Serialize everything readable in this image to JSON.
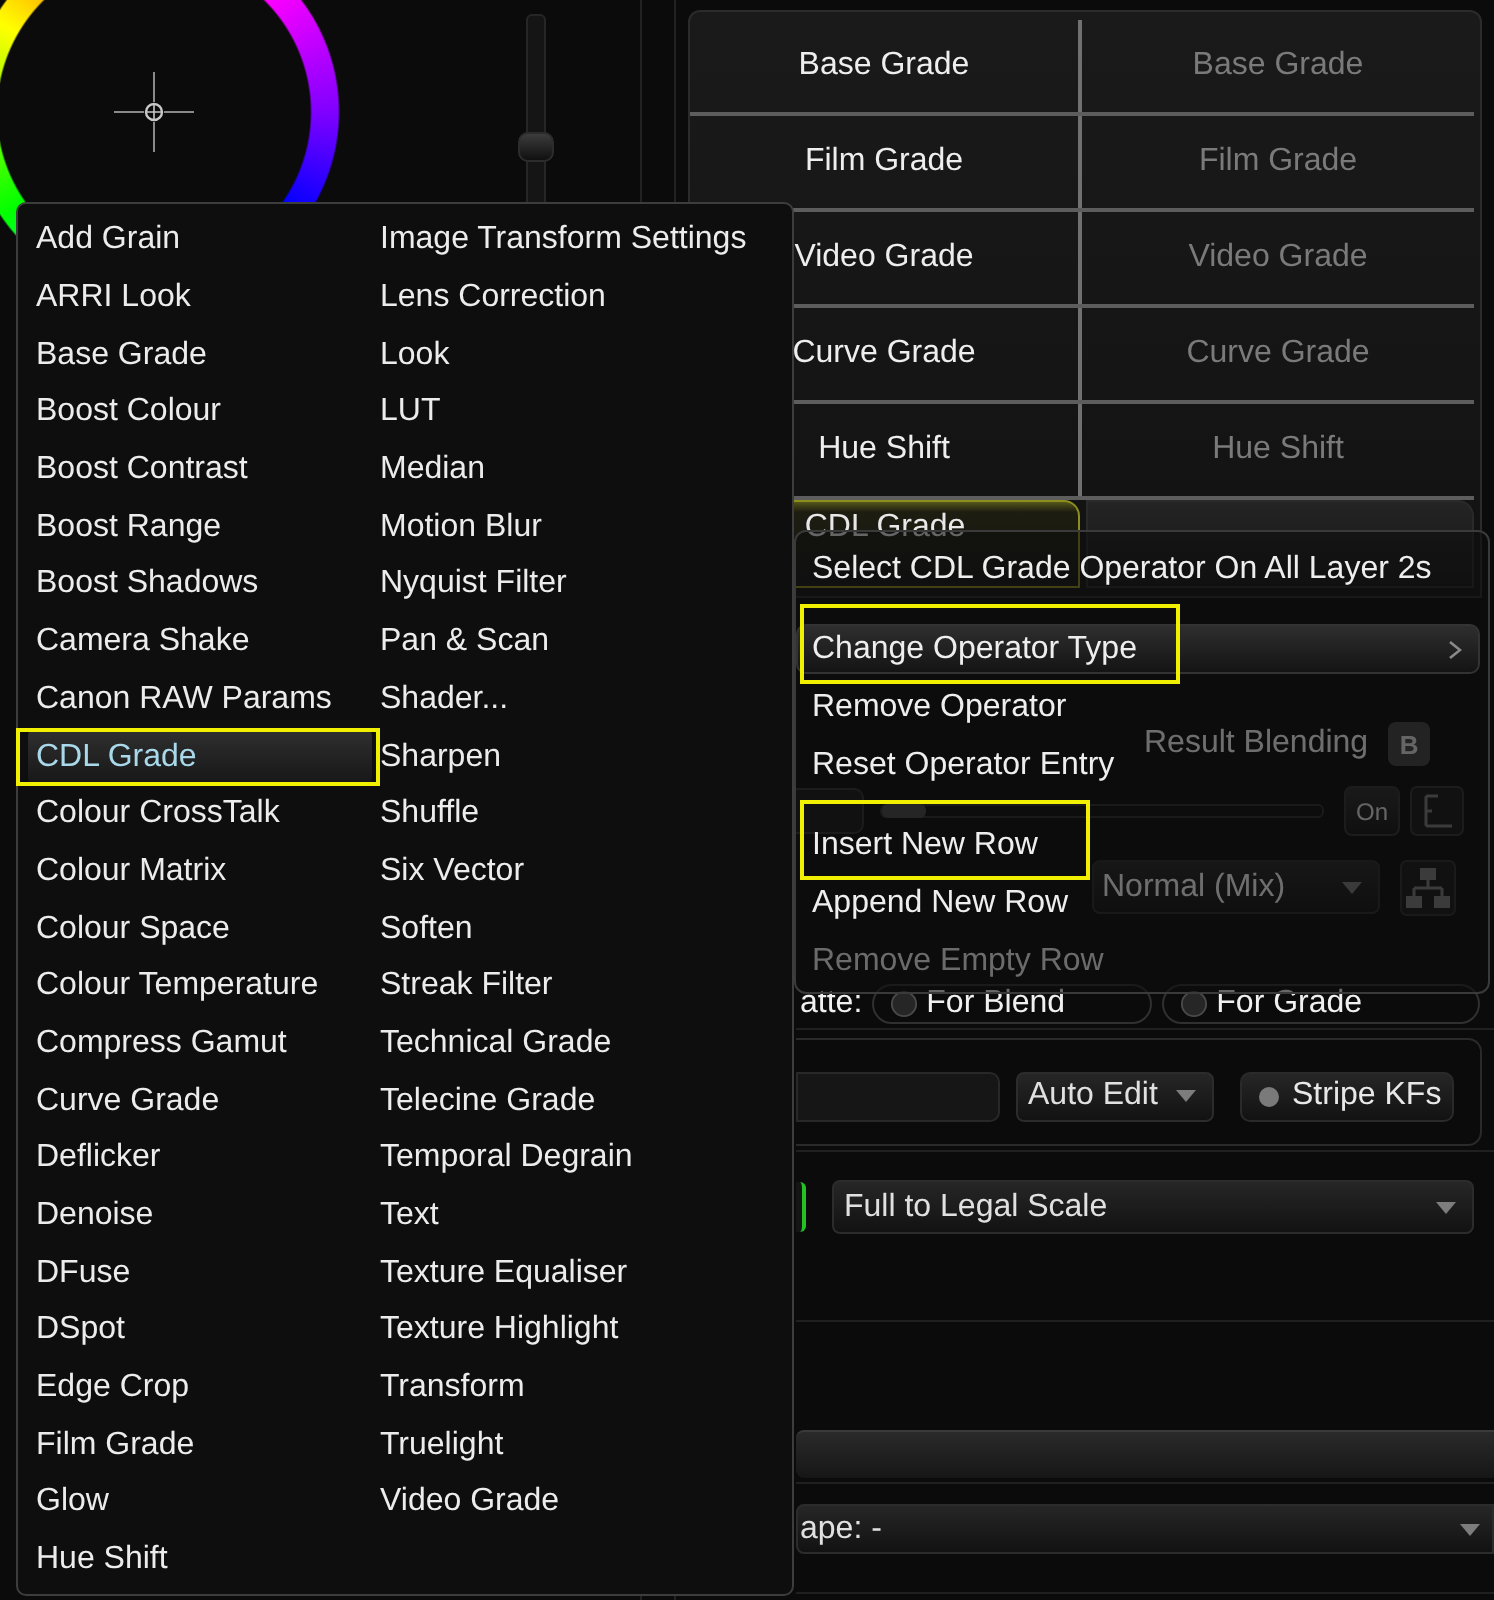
{
  "wheel_slider": {
    "level": 0.5
  },
  "grade_grid": {
    "rows": [
      {
        "kind": "cell",
        "cells": [
          {
            "label": "Base Grade",
            "disabled": false,
            "selected": false
          },
          {
            "label": "Base Grade",
            "disabled": true,
            "selected": false
          }
        ]
      },
      {
        "kind": "cell",
        "cells": [
          {
            "label": "Film Grade",
            "disabled": false,
            "selected": false
          },
          {
            "label": "Film Grade",
            "disabled": true,
            "selected": false
          }
        ]
      },
      {
        "kind": "cell",
        "cells": [
          {
            "label": "Video Grade",
            "disabled": false,
            "selected": false
          },
          {
            "label": "Video Grade",
            "disabled": true,
            "selected": false
          }
        ]
      },
      {
        "kind": "cell",
        "cells": [
          {
            "label": "Curve Grade",
            "disabled": false,
            "selected": false
          },
          {
            "label": "Curve Grade",
            "disabled": true,
            "selected": false
          }
        ]
      },
      {
        "kind": "cell",
        "cells": [
          {
            "label": "Hue Shift",
            "disabled": false,
            "selected": false
          },
          {
            "label": "Hue Shift",
            "disabled": true,
            "selected": false
          }
        ]
      },
      {
        "kind": "tile",
        "cells": [
          {
            "label": "CDL Grade",
            "disabled": false,
            "selected": true
          }
        ]
      }
    ]
  },
  "operator_panel": {
    "result_blending": {
      "label": "Result Blending",
      "badge": "B"
    },
    "mix_slider": {
      "level": 0,
      "button": "On"
    },
    "blend_mode": {
      "value": "Normal (Mix)"
    },
    "matte": {
      "label": "atte:",
      "options": [
        {
          "label": "For Blend",
          "selected": false
        },
        {
          "label": "For Grade",
          "selected": false
        }
      ]
    }
  },
  "keyframe_bar": {
    "mode": {
      "value": "Auto Edit"
    },
    "stripe_kfs": {
      "label": "Stripe KFs",
      "on": false
    }
  },
  "scale_row": {
    "indicator": {
      "on": true
    },
    "scale": {
      "value": "Full to Legal Scale"
    }
  },
  "shape_dropdown": {
    "value": "ape: -"
  },
  "context_menu": {
    "groups": [
      {
        "items": [
          {
            "label": "Select CDL Grade Operator On All Layer 2s",
            "selected": false,
            "disabled": false,
            "submenu": false,
            "annotated": false
          }
        ]
      },
      {
        "items": [
          {
            "label": "Change Operator Type",
            "selected": true,
            "disabled": false,
            "submenu": true,
            "annotated": true
          },
          {
            "label": "Remove Operator",
            "selected": false,
            "disabled": false,
            "submenu": false,
            "annotated": false
          },
          {
            "label": "Reset Operator Entry",
            "selected": false,
            "disabled": false,
            "submenu": false,
            "annotated": false
          }
        ]
      },
      {
        "items": [
          {
            "label": "Insert New Row",
            "selected": false,
            "disabled": false,
            "submenu": false,
            "annotated": true
          },
          {
            "label": "Append New Row",
            "selected": false,
            "disabled": false,
            "submenu": false,
            "annotated": false
          },
          {
            "label": "Remove Empty Row",
            "selected": false,
            "disabled": true,
            "submenu": false,
            "annotated": false
          }
        ]
      }
    ]
  },
  "operator_type_menu": {
    "columns": [
      {
        "items": [
          {
            "label": "Add Grain",
            "selected": false,
            "annotated": false
          },
          {
            "label": "ARRI Look",
            "selected": false,
            "annotated": false
          },
          {
            "label": "Base Grade",
            "selected": false,
            "annotated": false
          },
          {
            "label": "Boost Colour",
            "selected": false,
            "annotated": false
          },
          {
            "label": "Boost Contrast",
            "selected": false,
            "annotated": false
          },
          {
            "label": "Boost Range",
            "selected": false,
            "annotated": false
          },
          {
            "label": "Boost Shadows",
            "selected": false,
            "annotated": false
          },
          {
            "label": "Camera Shake",
            "selected": false,
            "annotated": false
          },
          {
            "label": "Canon RAW Params",
            "selected": false,
            "annotated": false
          },
          {
            "label": "CDL Grade",
            "selected": true,
            "annotated": true
          },
          {
            "label": "Colour CrossTalk",
            "selected": false,
            "annotated": false
          },
          {
            "label": "Colour Matrix",
            "selected": false,
            "annotated": false
          },
          {
            "label": "Colour Space",
            "selected": false,
            "annotated": false
          },
          {
            "label": "Colour Temperature",
            "selected": false,
            "annotated": false
          },
          {
            "label": "Compress Gamut",
            "selected": false,
            "annotated": false
          },
          {
            "label": "Curve Grade",
            "selected": false,
            "annotated": false
          },
          {
            "label": "Deflicker",
            "selected": false,
            "annotated": false
          },
          {
            "label": "Denoise",
            "selected": false,
            "annotated": false
          },
          {
            "label": "DFuse",
            "selected": false,
            "annotated": false
          },
          {
            "label": "DSpot",
            "selected": false,
            "annotated": false
          },
          {
            "label": "Edge Crop",
            "selected": false,
            "annotated": false
          },
          {
            "label": "Film Grade",
            "selected": false,
            "annotated": false
          },
          {
            "label": "Glow",
            "selected": false,
            "annotated": false
          },
          {
            "label": "Hue Shift",
            "selected": false,
            "annotated": false
          }
        ]
      },
      {
        "items": [
          {
            "label": "Image Transform Settings",
            "selected": false,
            "annotated": false
          },
          {
            "label": "Lens Correction",
            "selected": false,
            "annotated": false
          },
          {
            "label": "Look",
            "selected": false,
            "annotated": false
          },
          {
            "label": "LUT",
            "selected": false,
            "annotated": false
          },
          {
            "label": "Median",
            "selected": false,
            "annotated": false
          },
          {
            "label": "Motion Blur",
            "selected": false,
            "annotated": false
          },
          {
            "label": "Nyquist Filter",
            "selected": false,
            "annotated": false
          },
          {
            "label": "Pan & Scan",
            "selected": false,
            "annotated": false
          },
          {
            "label": "Shader...",
            "selected": false,
            "annotated": false
          },
          {
            "label": "Sharpen",
            "selected": false,
            "annotated": false
          },
          {
            "label": "Shuffle",
            "selected": false,
            "annotated": false
          },
          {
            "label": "Six Vector",
            "selected": false,
            "annotated": false
          },
          {
            "label": "Soften",
            "selected": false,
            "annotated": false
          },
          {
            "label": "Streak Filter",
            "selected": false,
            "annotated": false
          },
          {
            "label": "Technical Grade",
            "selected": false,
            "annotated": false
          },
          {
            "label": "Telecine Grade",
            "selected": false,
            "annotated": false
          },
          {
            "label": "Temporal Degrain",
            "selected": false,
            "annotated": false
          },
          {
            "label": "Text",
            "selected": false,
            "annotated": false
          },
          {
            "label": "Texture Equaliser",
            "selected": false,
            "annotated": false
          },
          {
            "label": "Texture Highlight",
            "selected": false,
            "annotated": false
          },
          {
            "label": "Transform",
            "selected": false,
            "annotated": false
          },
          {
            "label": "Truelight",
            "selected": false,
            "annotated": false
          },
          {
            "label": "Video Grade",
            "selected": false,
            "annotated": false
          }
        ]
      }
    ]
  }
}
